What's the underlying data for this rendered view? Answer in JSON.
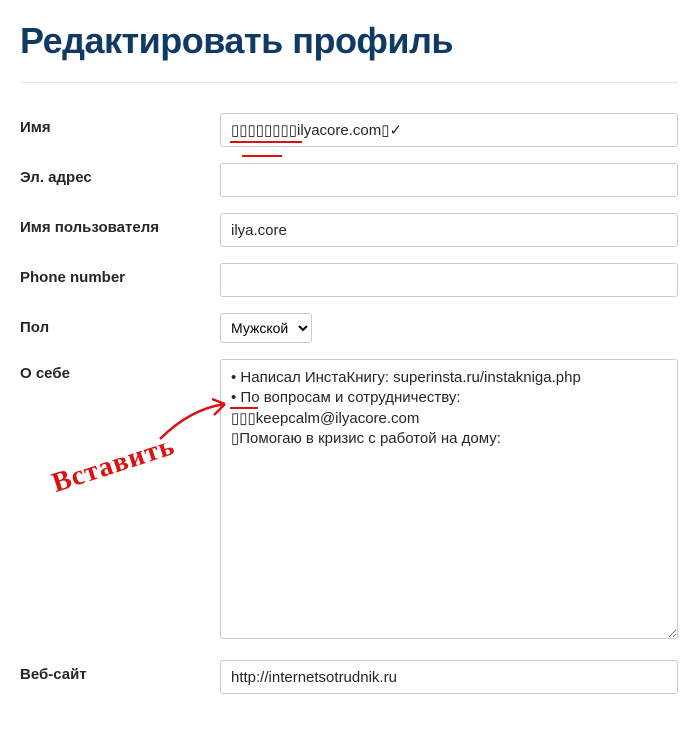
{
  "title": "Редактировать профиль",
  "fields": {
    "name": {
      "label": "Имя",
      "value": "▯▯▯▯▯▯▯▯ilyacore.com▯✓"
    },
    "email": {
      "label": "Эл. адрес",
      "value": ""
    },
    "username": {
      "label": "Имя пользователя",
      "value": "ilya.core"
    },
    "phone": {
      "label": "Phone number",
      "value": ""
    },
    "gender": {
      "label": "Пол",
      "value": "Мужской"
    },
    "about": {
      "label": "О себе",
      "value": "• Написал ИнстаКнигу: superinsta.ru/instakniga.php\n• По вопросам и сотрудничеству:\n▯▯▯keepcalm@ilyacore.com\n▯Помогаю в кризис с работой на дому:"
    },
    "website": {
      "label": "Веб-сайт",
      "value": "http://internetsotrudnik.ru"
    }
  },
  "annotation": "Вставить"
}
